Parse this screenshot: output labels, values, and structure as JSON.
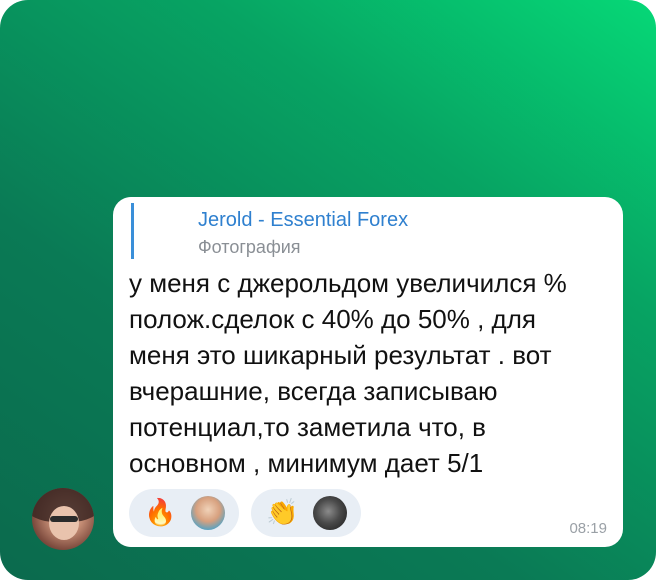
{
  "chat": {
    "reply": {
      "author": "Jerold - Essential Forex",
      "media_type": "Фотография"
    },
    "message_lines": [
      "у меня с джерольдом увеличился %",
      "полож.сделок с 40% до 50% , для",
      "меня это шикарный результат . вот",
      "вчерашние, всегда записываю",
      "потенциал,то заметила что, в",
      "основном , минимум дает 5/1"
    ],
    "reactions": [
      {
        "emoji": "🔥"
      },
      {
        "emoji": "👏"
      }
    ],
    "time": "08:19"
  },
  "colors": {
    "background_start": "#0b6a4d",
    "background_end": "#06d877",
    "reply_accent": "#3a8fd9",
    "reply_author": "#2f80cf",
    "reaction_pill": "#e8eef5"
  }
}
